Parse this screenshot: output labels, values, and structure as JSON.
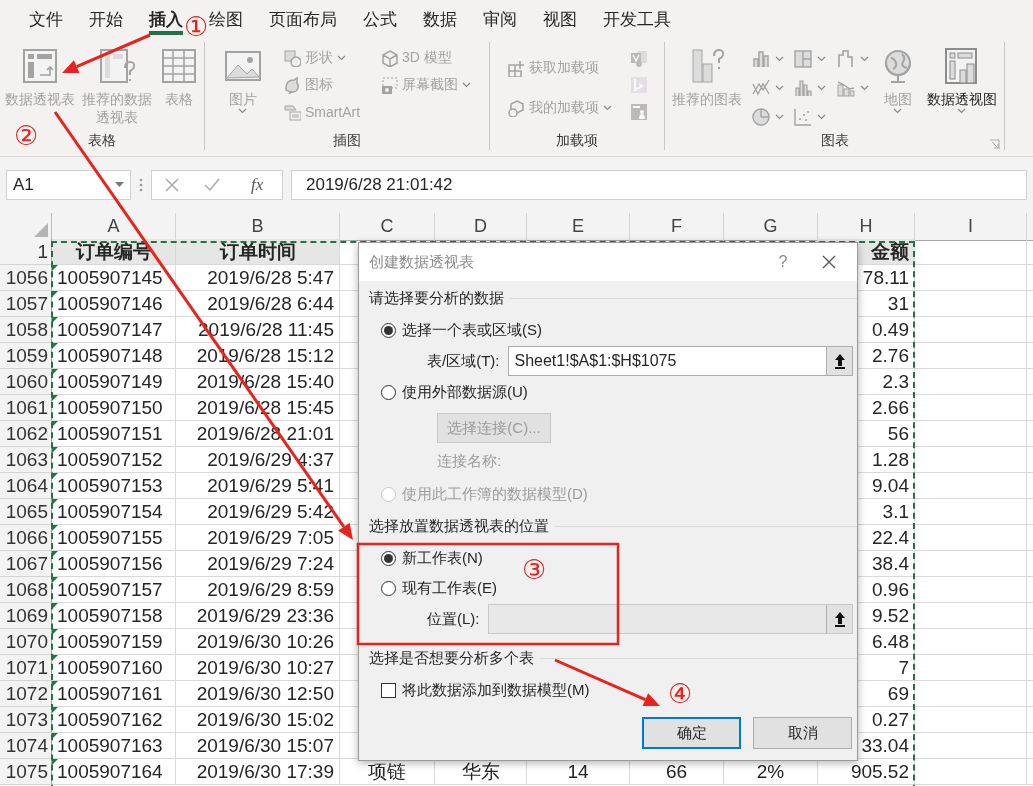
{
  "ribbon_tabs": [
    {
      "label": "文件",
      "selected": false
    },
    {
      "label": "开始",
      "selected": false
    },
    {
      "label": "插入",
      "selected": true
    },
    {
      "label": "绘图",
      "selected": false
    },
    {
      "label": "页面布局",
      "selected": false
    },
    {
      "label": "公式",
      "selected": false
    },
    {
      "label": "数据",
      "selected": false
    },
    {
      "label": "审阅",
      "selected": false
    },
    {
      "label": "视图",
      "selected": false
    },
    {
      "label": "开发工具",
      "selected": false
    }
  ],
  "ribbon_groups": [
    {
      "label": "表格",
      "items": [
        {
          "kind": "large",
          "label": "数据透视表",
          "disabled": true,
          "dropdown": false
        },
        {
          "kind": "large",
          "label": "推荐的数据透视表",
          "disabled": true,
          "dropdown": false
        },
        {
          "kind": "large",
          "label": "表格",
          "disabled": true,
          "dropdown": false
        }
      ]
    },
    {
      "label": "插图",
      "items": [
        {
          "kind": "large",
          "label": "图片",
          "disabled": true,
          "dropdown": true
        },
        {
          "kind": "small",
          "label": "形状",
          "disabled": true,
          "dropdown": true
        },
        {
          "kind": "small",
          "label": "图标",
          "disabled": true,
          "dropdown": false
        },
        {
          "kind": "small",
          "label": "SmartArt",
          "disabled": true,
          "dropdown": false
        },
        {
          "kind": "small",
          "label": "3D 模型",
          "disabled": true,
          "dropdown": false
        },
        {
          "kind": "small",
          "label": "屏幕截图",
          "disabled": true,
          "dropdown": true
        }
      ]
    },
    {
      "label": "加载项",
      "items": [
        {
          "kind": "small",
          "label": "获取加载项",
          "disabled": true,
          "dropdown": false
        },
        {
          "kind": "small",
          "label": "我的加载项",
          "disabled": true,
          "dropdown": true
        },
        {
          "kind": "icon",
          "disabled": true
        },
        {
          "kind": "icon",
          "disabled": true
        },
        {
          "kind": "icon",
          "disabled": true
        }
      ]
    },
    {
      "label": "图表",
      "items": [
        {
          "kind": "large",
          "label": "推荐的图表",
          "disabled": true,
          "dropdown": false
        },
        {
          "kind": "gallery",
          "disabled": true
        },
        {
          "kind": "gallery",
          "disabled": true
        },
        {
          "kind": "gallery",
          "disabled": true
        },
        {
          "kind": "gallery",
          "disabled": true
        },
        {
          "kind": "gallery",
          "disabled": true
        },
        {
          "kind": "gallery",
          "disabled": true
        },
        {
          "kind": "gallery",
          "disabled": true
        },
        {
          "kind": "gallery",
          "disabled": true
        },
        {
          "kind": "large",
          "label": "地图",
          "disabled": true,
          "dropdown": true
        },
        {
          "kind": "large",
          "label": "数据透视图",
          "disabled": false,
          "dropdown": true
        }
      ]
    }
  ],
  "formula_bar": {
    "name_box": "A1",
    "function_button": "fx",
    "value": "2019/6/28  21:01:42"
  },
  "columns": [
    "A",
    "B",
    "C",
    "D",
    "E",
    "F",
    "G",
    "H",
    "I"
  ],
  "header_row": {
    "row": "1",
    "a": "订单编号",
    "b": "订单时间",
    "h": "金额"
  },
  "rows": [
    {
      "row": "1056",
      "a": "1005907145",
      "b": "2019/6/28 5:47",
      "h": "78.11"
    },
    {
      "row": "1057",
      "a": "1005907146",
      "b": "2019/6/28 6:44",
      "h": "31"
    },
    {
      "row": "1058",
      "a": "1005907147",
      "b": "2019/6/28 11:45",
      "h": "0.49"
    },
    {
      "row": "1059",
      "a": "1005907148",
      "b": "2019/6/28 15:12",
      "h": "2.76"
    },
    {
      "row": "1060",
      "a": "1005907149",
      "b": "2019/6/28 15:40",
      "h": "2.3"
    },
    {
      "row": "1061",
      "a": "1005907150",
      "b": "2019/6/28 15:45",
      "h": "2.66"
    },
    {
      "row": "1062",
      "a": "1005907151",
      "b": "2019/6/28 21:01",
      "h": "56"
    },
    {
      "row": "1063",
      "a": "1005907152",
      "b": "2019/6/29 4:37",
      "h": "1.28"
    },
    {
      "row": "1064",
      "a": "1005907153",
      "b": "2019/6/29 5:41",
      "h": "9.04"
    },
    {
      "row": "1065",
      "a": "1005907154",
      "b": "2019/6/29 5:42",
      "h": "3.1"
    },
    {
      "row": "1066",
      "a": "1005907155",
      "b": "2019/6/29 7:05",
      "h": "22.4"
    },
    {
      "row": "1067",
      "a": "1005907156",
      "b": "2019/6/29 7:24",
      "h": "38.4"
    },
    {
      "row": "1068",
      "a": "1005907157",
      "b": "2019/6/29 8:59",
      "h": "0.96"
    },
    {
      "row": "1069",
      "a": "1005907158",
      "b": "2019/6/29 23:36",
      "h": "9.52"
    },
    {
      "row": "1070",
      "a": "1005907159",
      "b": "2019/6/30 10:26",
      "h": "6.48"
    },
    {
      "row": "1071",
      "a": "1005907160",
      "b": "2019/6/30 10:27",
      "h": "7"
    },
    {
      "row": "1072",
      "a": "1005907161",
      "b": "2019/6/30 12:50",
      "h": "69"
    },
    {
      "row": "1073",
      "a": "1005907162",
      "b": "2019/6/30 15:02",
      "h": "0.27"
    },
    {
      "row": "1074",
      "a": "1005907163",
      "b": "2019/6/30 15:07",
      "h": "33.04"
    },
    {
      "row": "1075",
      "a": "1005907164",
      "b": "2019/6/30 17:39",
      "c": "项链",
      "d": "华东",
      "e": "14",
      "f": "66",
      "g": "2%",
      "h": "905.52"
    }
  ],
  "dialog": {
    "title": "创建数据透视表",
    "help": "?",
    "source_heading": "请选择要分析的数据",
    "source_options": [
      {
        "label": "选择一个表或区域(S)",
        "selected": true,
        "disabled": false
      },
      {
        "label": "使用外部数据源(U)",
        "selected": false,
        "disabled": false
      },
      {
        "label": "使用此工作簿的数据模型(D)",
        "selected": false,
        "disabled": true
      }
    ],
    "range_field": {
      "label": "表/区域(T):",
      "value": "Sheet1!$A$1:$H$1075"
    },
    "connection_button": {
      "label": "选择连接(C)...",
      "disabled": true
    },
    "connection_name": {
      "label": "连接名称:",
      "disabled": true
    },
    "location_heading": "选择放置数据透视表的位置",
    "location_options": [
      {
        "label": "新工作表(N)",
        "selected": true
      },
      {
        "label": "现有工作表(E)",
        "selected": false
      }
    ],
    "location_field": {
      "label": "位置(L):",
      "disabled": true
    },
    "multi_heading": "选择是否想要分析多个表",
    "data_model_checkbox": {
      "label": "将此数据添加到数据模型(M)",
      "checked": false
    },
    "buttons": [
      {
        "label": "确定",
        "default": true
      },
      {
        "label": "取消",
        "default": false
      }
    ]
  },
  "annotations": [
    {
      "label": "①"
    },
    {
      "label": "②"
    },
    {
      "label": "③"
    },
    {
      "label": "④"
    }
  ]
}
